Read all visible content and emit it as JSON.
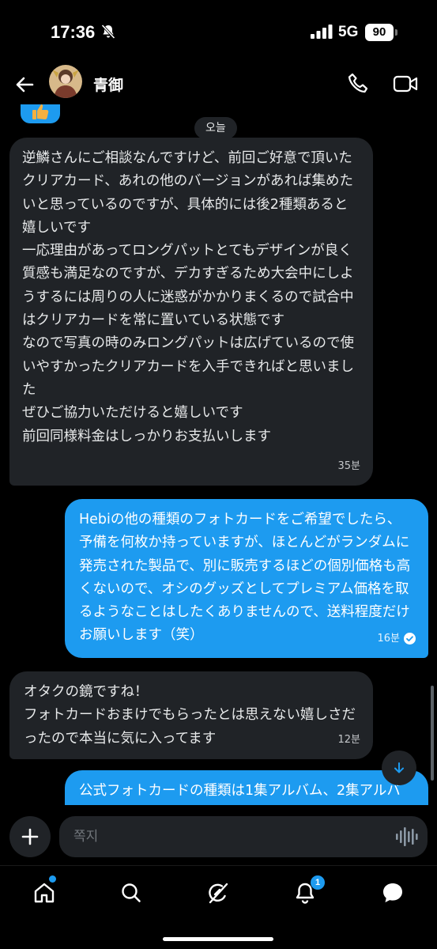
{
  "status_bar": {
    "time": "17:36",
    "network": "5G",
    "battery": "90"
  },
  "header": {
    "contact_name": "青御"
  },
  "chat": {
    "date_divider": "오늘",
    "messages": [
      {
        "direction": "incoming",
        "text": "逆鱗さんにご相談なんですけど、前回ご好意で頂いたクリアカード、あれの他のバージョンがあれば集めたいと思っているのですが、具体的には後2種類あると嬉しいです\n一応理由があってロングパットとてもデザインが良く質感も満足なのですが、デカすぎるため大会中にしようするには周りの人に迷惑がかかりまくるので試合中はクリアカードを常に置いている状態です\nなので写真の時のみロングパットは広げているので使いやすかったクリアカードを入手できればと思いました\nぜひご協力いただけると嬉しいです\n前回同様料金はしっかりお支払いします",
        "time": "35분"
      },
      {
        "direction": "outgoing",
        "text": "Hebiの他の種類のフォトカードをご希望でしたら、予備を何枚か持っていますが、ほとんどがランダムに発売された製品で、別に販売するほどの個別価格も高くないので、オシのグッズとしてプレミアム価格を取るようなことはしたくありませんので、送料程度だけお願いします（笑）",
        "time": "16분",
        "read": true
      },
      {
        "direction": "incoming",
        "text": "オタクの鏡ですね！\nフォトカードおまけでもらったとは思えない嬉しさだったので本当に気に入ってます",
        "time": "12분"
      },
      {
        "direction": "outgoing",
        "text": "公式フォトカードの種類は1集アルバム、2集アルバ",
        "time": ""
      }
    ]
  },
  "composer": {
    "placeholder": "쪽지"
  },
  "bottom_nav": {
    "items": [
      "home",
      "search",
      "grok",
      "notifications",
      "messages"
    ],
    "notifications_count": "1"
  },
  "colors": {
    "accent": "#1d9bf0",
    "incoming_bubble": "#202327",
    "background": "#000000"
  }
}
